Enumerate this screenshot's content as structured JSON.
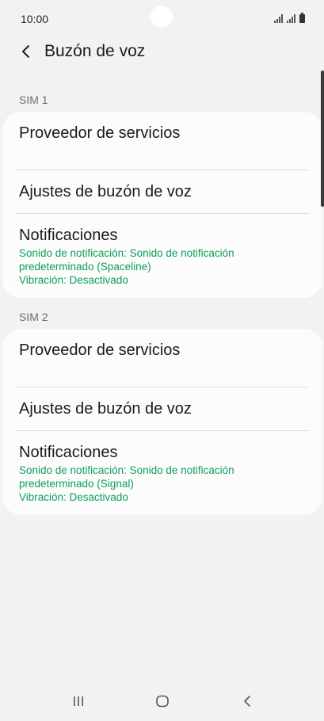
{
  "status_bar": {
    "time": "10:00"
  },
  "header": {
    "title": "Buzón de voz"
  },
  "sims": [
    {
      "label": "SIM 1",
      "provider": "Proveedor de servicios",
      "settings": "Ajustes de buzón de voz",
      "notifications": {
        "title": "Notificaciones",
        "line1": "Sonido de notificación: Sonido de notificación",
        "line2": "predeterminado (Spaceline)",
        "line3": "Vibración: Desactivado"
      }
    },
    {
      "label": "SIM 2",
      "provider": "Proveedor de servicios",
      "settings": "Ajustes de buzón de voz",
      "notifications": {
        "title": "Notificaciones",
        "line1": "Sonido de notificación: Sonido de notificación",
        "line2": "predeterminado (Signal)",
        "line3": "Vibración: Desactivado"
      }
    }
  ],
  "colors": {
    "accent": "#0c9e58",
    "background": "#f2f2f2",
    "card": "#fcfcfc"
  },
  "icons": {
    "back": "chevron-left-icon",
    "recents": "recents-icon",
    "home": "home-icon",
    "nav_back": "nav-back-icon"
  }
}
